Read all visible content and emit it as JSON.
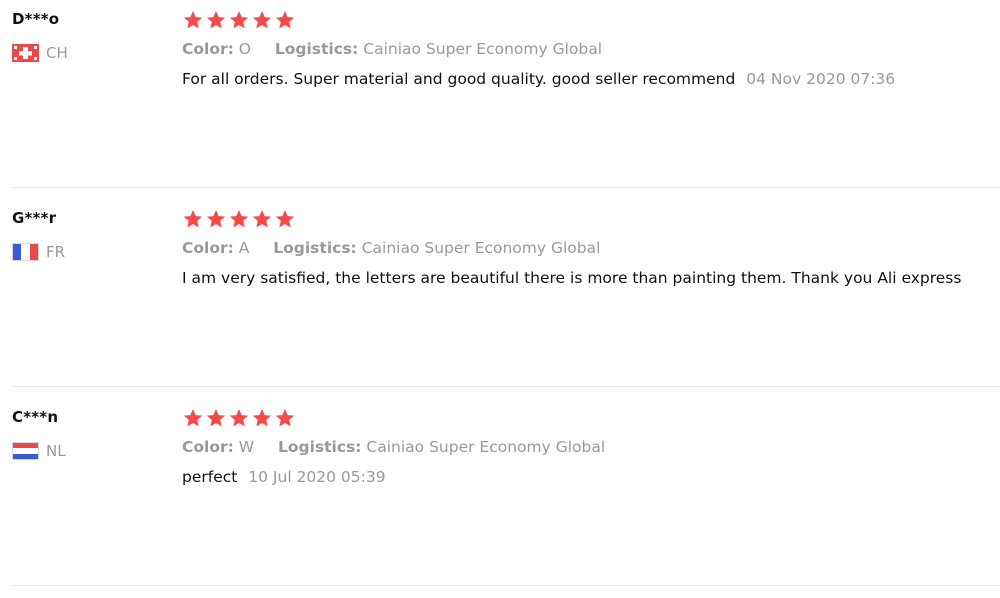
{
  "colors": {
    "star": "#f44a4a",
    "muted_text": "#999999",
    "body_text": "#111111",
    "divider": "#e8e8e8"
  },
  "labels": {
    "color": "Color:",
    "logistics": "Logistics:"
  },
  "reviews": [
    {
      "user": "D***o",
      "country_code": "CH",
      "flag_icon": "switzerland-flag-icon",
      "rating": 5,
      "color_value": "O",
      "logistics_value": "Cainiao Super Economy Global",
      "text": "For all orders. Super material and good quality. good seller recommend",
      "date": "04 Nov 2020 07:36"
    },
    {
      "user": "G***r",
      "country_code": "FR",
      "flag_icon": "france-flag-icon",
      "rating": 5,
      "color_value": "A",
      "logistics_value": "Cainiao Super Economy Global",
      "text": "I am very satisfied, the letters are beautiful there is more than painting them. Thank you Ali express",
      "date": ""
    },
    {
      "user": "C***n",
      "country_code": "NL",
      "flag_icon": "netherlands-flag-icon",
      "rating": 5,
      "color_value": "W",
      "logistics_value": "Cainiao Super Economy Global",
      "text": "perfect",
      "date": "10 Jul 2020 05:39"
    }
  ]
}
